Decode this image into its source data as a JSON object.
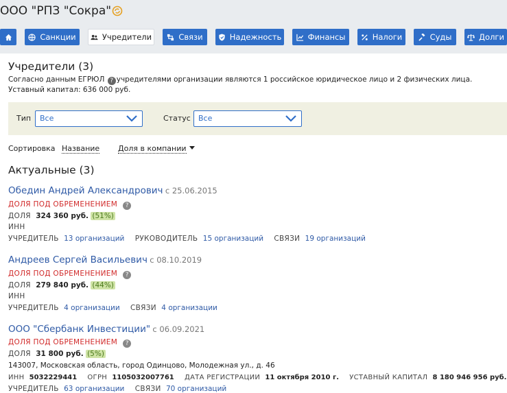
{
  "header": {
    "company_name": "ООО \"РПЗ \"Сокра\"",
    "title_icon": "refresh-orange-icon",
    "nav": [
      {
        "label": "",
        "icon": "home-icon"
      },
      {
        "label": "Санкции",
        "icon": "globe-icon"
      },
      {
        "label": "Учредители",
        "icon": "users-icon",
        "active": true
      },
      {
        "label": "Связи",
        "icon": "links-icon"
      },
      {
        "label": "Надежность",
        "icon": "shield-icon"
      },
      {
        "label": "Финансы",
        "icon": "chart-icon"
      },
      {
        "label": "Налоги",
        "icon": "percent-icon"
      },
      {
        "label": "Суды",
        "icon": "gavel-icon"
      },
      {
        "label": "Долги",
        "icon": "scales-icon"
      }
    ]
  },
  "founders": {
    "title": "Учредители (3)",
    "desc_before": "Согласно данным ЕГРЮЛ",
    "desc_after": "учредителями организации являются 1 российское юридическое лицо и 2 физических лица.",
    "capital": "Уставный капитал: 636 000 руб."
  },
  "filter": {
    "type_label": "Тип",
    "type_value": "Все",
    "status_label": "Статус",
    "status_value": "Все"
  },
  "sort": {
    "label": "Сортировка",
    "by_name": "Название",
    "by_share": "Доля в компании"
  },
  "current": {
    "title": "Актуальные (3)",
    "items": [
      {
        "name": "Обедин Андрей Александрович",
        "since": "с 25.06.2015",
        "burden": "ДОЛЯ ПОД ОБРЕМЕНЕНИЕМ",
        "share_label": "ДОЛЯ",
        "share_value": "324 360 руб.",
        "share_pct": "(51%)",
        "inn_label": "ИНН",
        "roles": [
          {
            "label": "УЧРЕДИТЕЛЬ",
            "value": "13 организаций"
          },
          {
            "label": "РУКОВОДИТЕЛЬ",
            "value": "15 организаций"
          },
          {
            "label": "СВЯЗИ",
            "value": "19 организаций"
          }
        ]
      },
      {
        "name": "Андреев Сергей Васильевич",
        "since": "с 08.10.2019",
        "burden": "ДОЛЯ ПОД ОБРЕМЕНЕНИЕМ",
        "share_label": "ДОЛЯ",
        "share_value": "279 840 руб.",
        "share_pct": "(44%)",
        "inn_label": "ИНН",
        "roles": [
          {
            "label": "УЧРЕДИТЕЛЬ",
            "value": "4 организации"
          },
          {
            "label": "СВЯЗИ",
            "value": "4 организации"
          }
        ]
      },
      {
        "name": "ООО \"Сбербанк Инвестиции\"",
        "since": "с 06.09.2021",
        "burden": "ДОЛЯ ПОД ОБРЕМЕНЕНИЕМ",
        "share_label": "ДОЛЯ",
        "share_value": "31 800 руб.",
        "share_pct": "(5%)",
        "address": "143007, Московская область, город Одинцово, Молодежная ул., д. 46",
        "inn_label": "ИНН",
        "inn": "5032229441",
        "ogrn_label": "ОГРН",
        "ogrn": "1105032007761",
        "reg_label": "ДАТА РЕГИСТРАЦИИ",
        "reg": "11 октября 2010 г.",
        "capital_label": "УСТАВНЫЙ КАПИТАЛ",
        "capital": "8 180 946 956 руб.",
        "roles": [
          {
            "label": "УЧРЕДИТЕЛЬ",
            "value": "63 организации"
          },
          {
            "label": "СВЯЗИ",
            "value": "70 организаций"
          }
        ]
      }
    ]
  },
  "colors": {
    "accent": "#2f6ec8",
    "link": "#2f5aa6",
    "burden": "#d12a2a",
    "pct_bg": "#cfe3a6",
    "filter_bg": "#f0f0e2"
  }
}
